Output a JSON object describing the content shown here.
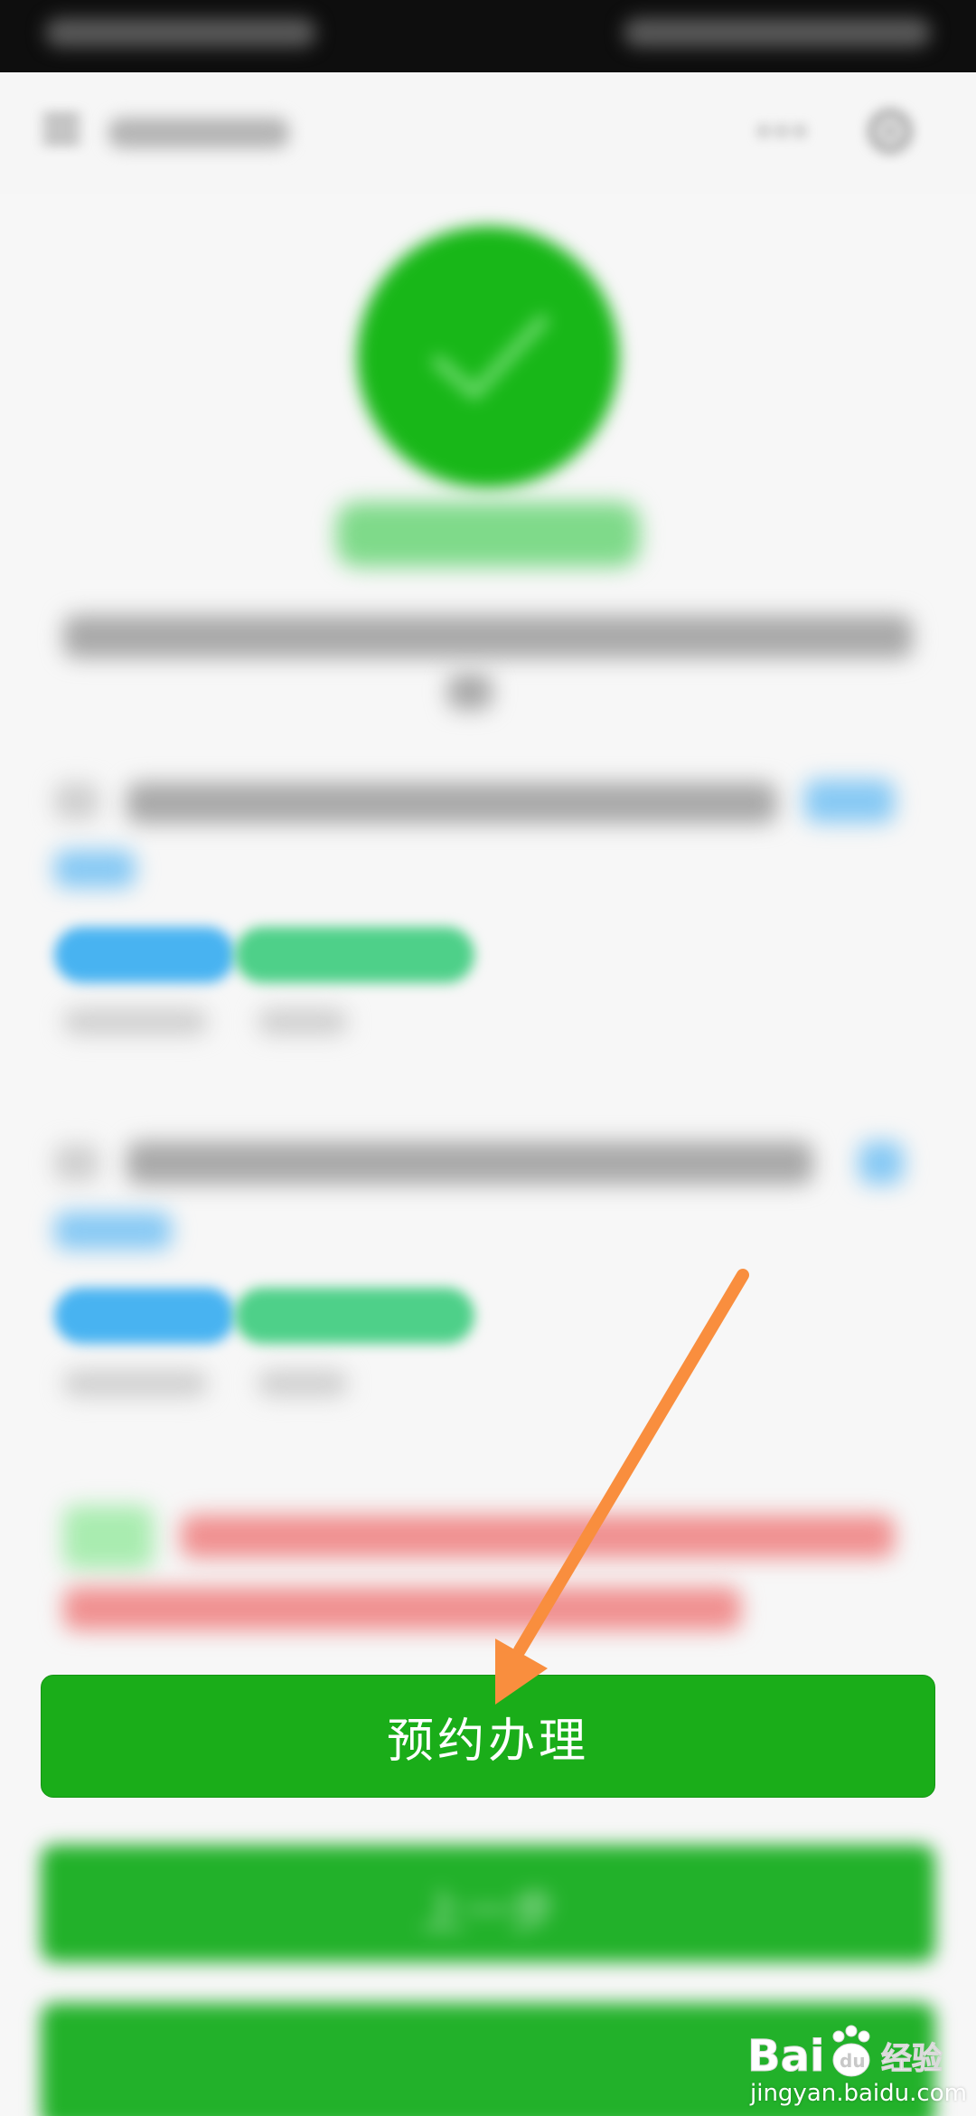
{
  "primary_button": {
    "label": "预约办理"
  },
  "secondary_button": {
    "label": "上一步"
  },
  "watermark": {
    "logo_text": "Bai",
    "logo_suffix": "经验",
    "url": "jingyan.baidu.com"
  },
  "colors": {
    "primary": "#1aad19",
    "arrow": "#f98e3e",
    "pill_blue": "#48b3f1",
    "pill_green": "#4ed089",
    "alert_red": "#f09090"
  },
  "icons": {
    "success": "check-circle-icon",
    "back": "menu-back-icon",
    "more": "more-icon",
    "close": "close-icon",
    "arrow": "orange-arrow-annotation"
  }
}
